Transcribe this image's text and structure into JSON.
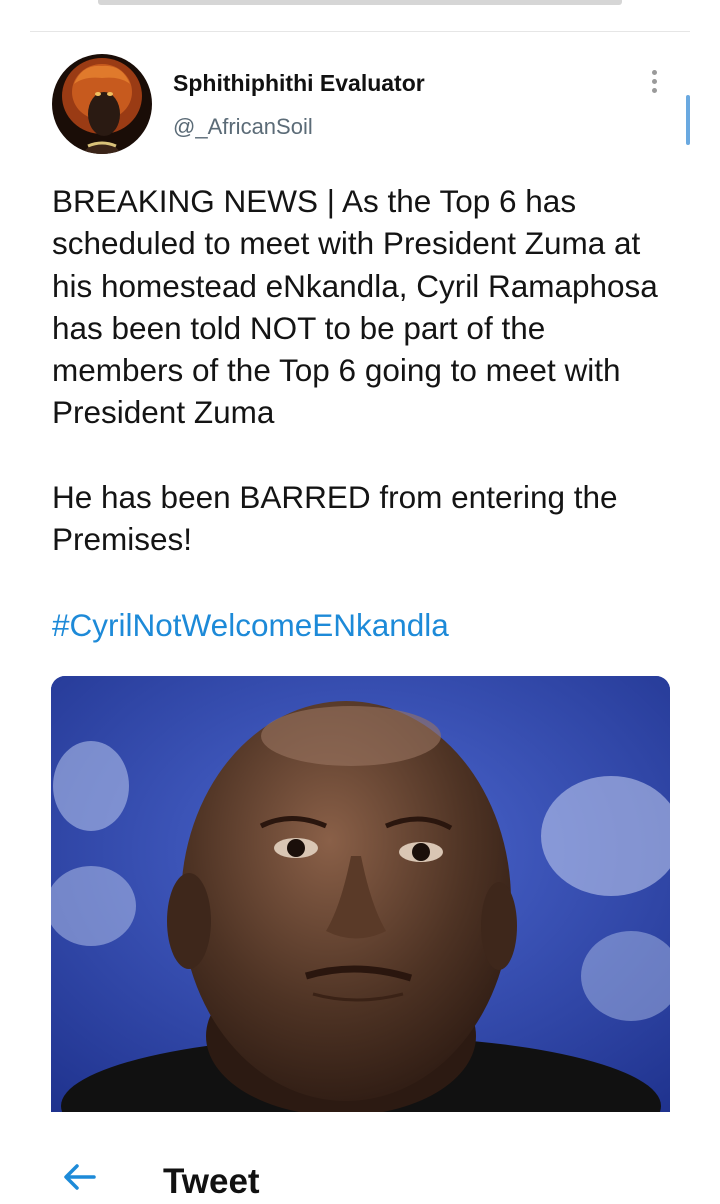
{
  "tweet": {
    "author": {
      "display_name": "Sphithiphithi Evaluator",
      "handle": "@_AfricanSoil",
      "avatar_icon": "lion-mask-avatar"
    },
    "paragraphs": [
      "BREAKING NEWS | As the Top 6 has scheduled to meet with President Zuma at his homestead eNkandla, Cyril Ramaphosa has been told NOT to be part of the members of the Top 6 going to meet with President Zuma",
      "He has been BARRED from entering the Premises!"
    ],
    "hashtag": "#CyrilNotWelcomeENkandla",
    "more_icon": "more-vertical-icon",
    "media_description_icon": "photo"
  },
  "header": {
    "back_icon": "arrow-left-icon",
    "title": "Tweet"
  },
  "colors": {
    "link": "#1d8ad8",
    "accent_indicator": "#6aa9e0",
    "handle": "#5b6b77",
    "media_background": "#2b44a8"
  }
}
